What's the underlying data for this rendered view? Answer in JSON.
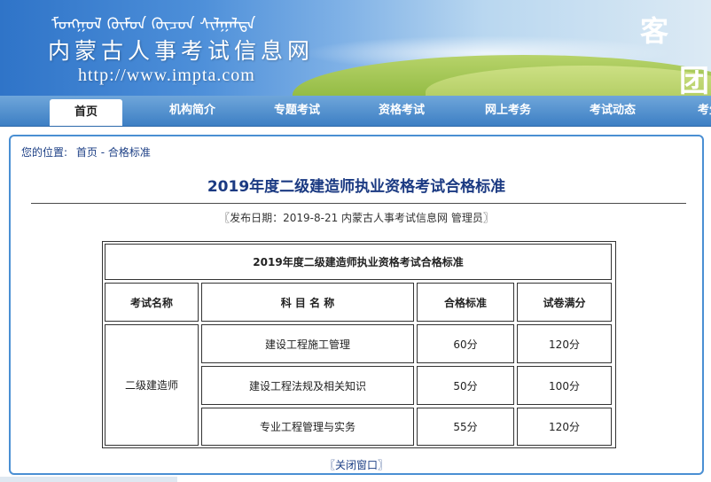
{
  "header": {
    "mongolian_script": "ᠮᠣᠩᠭᠣᠯ ᠬᠦᠮᠦᠨ ᠬᠦᠴᠦᠨ ᠰᠢᠯᠭᠠᠯᠲᠠ",
    "site_title": "内蒙古人事考试信息网",
    "site_url": "http://www.impta.com",
    "corner_text_1": "客",
    "corner_text_2": "团"
  },
  "nav": {
    "items": [
      {
        "label": "首页",
        "active": true
      },
      {
        "label": "机构简介"
      },
      {
        "label": "专题考试"
      },
      {
        "label": "资格考试"
      },
      {
        "label": "网上考务"
      },
      {
        "label": "考试动态"
      },
      {
        "label": "考生"
      }
    ]
  },
  "breadcrumb": {
    "prefix": "您的位置:",
    "home": "首页",
    "separator": "-",
    "current": "合格标准"
  },
  "article": {
    "title": "2019年度二级建造师执业资格考试合格标准",
    "pubinfo": "〖发布日期：2019-8-21 内蒙古人事考试信息网 管理员〗"
  },
  "table": {
    "caption": "2019年度二级建造师执业资格考试合格标准",
    "headers": [
      "考试名称",
      "科 目 名 称",
      "合格标准",
      "试卷满分"
    ],
    "exam_name": "二级建造师",
    "rows": [
      {
        "subject": "建设工程施工管理",
        "pass": "60分",
        "full": "120分"
      },
      {
        "subject": "建设工程法规及相关知识",
        "pass": "50分",
        "full": "100分"
      },
      {
        "subject": "专业工程管理与实务",
        "pass": "55分",
        "full": "120分"
      }
    ]
  },
  "footer": {
    "close_label": "〖关闭窗口〗"
  },
  "colors": {
    "nav_bg": "#3d7fc4",
    "title_color": "#1b3a82",
    "panel_border": "#4a8fd3"
  }
}
